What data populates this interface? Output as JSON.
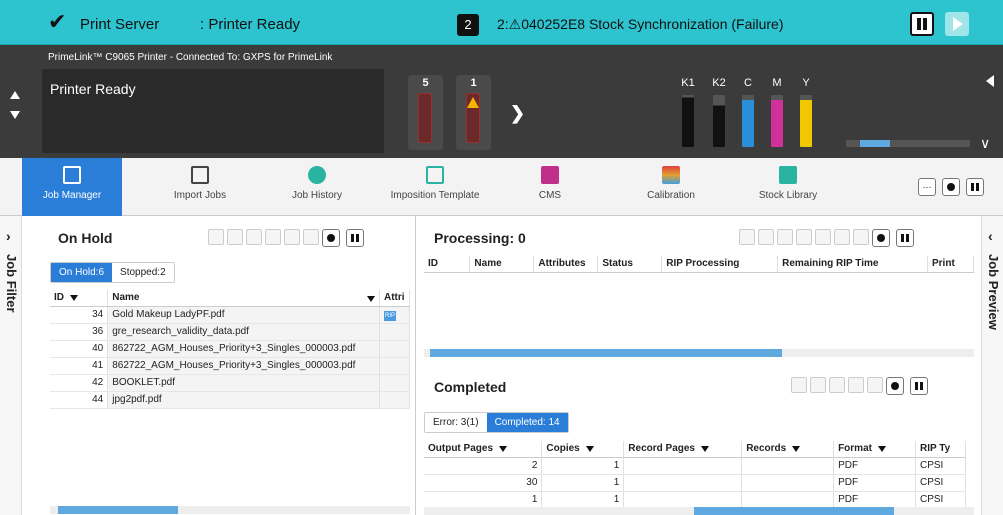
{
  "status_bar": {
    "server_label": "Print Server",
    "printer_status": ": Printer Ready",
    "job_count": "2",
    "message": "2:⚠040252E8 Stock Synchronization (Failure)"
  },
  "printer": {
    "connection": "PrimeLink™ C9065 Printer - Connected To: GXPS for PrimeLink",
    "screen_text": "Printer Ready",
    "trays": [
      {
        "label": "5",
        "warning": false
      },
      {
        "label": "1",
        "warning": true
      }
    ],
    "inks": [
      {
        "label": "K1",
        "color": "#111111",
        "level": 0.95
      },
      {
        "label": "K2",
        "color": "#111111",
        "level": 0.8
      },
      {
        "label": "C",
        "color": "#2a8fd8",
        "level": 0.9
      },
      {
        "label": "M",
        "color": "#d0309a",
        "level": 0.9
      },
      {
        "label": "Y",
        "color": "#f0c800",
        "level": 0.9
      }
    ]
  },
  "nav": {
    "items": [
      {
        "label": "Job Manager",
        "icon": "job-manager-icon",
        "color": "#ffffff"
      },
      {
        "label": "Import Jobs",
        "icon": "import-icon",
        "color": "#444444"
      },
      {
        "label": "Job History",
        "icon": "history-icon",
        "color": "#2ab3a0"
      },
      {
        "label": "Imposition Template",
        "icon": "imposition-icon",
        "color": "#2ab3a0"
      },
      {
        "label": "CMS",
        "icon": "cms-icon",
        "color": "#c0308a"
      },
      {
        "label": "Calibration",
        "icon": "calibration-icon",
        "color": "#e08a30"
      },
      {
        "label": "Stock Library",
        "icon": "stock-library-icon",
        "color": "#2ab3a0"
      }
    ]
  },
  "sidebars": {
    "left": "Job Filter",
    "right": "Job Preview"
  },
  "on_hold": {
    "title": "On Hold",
    "tabs": [
      "On Hold:6",
      "Stopped:2"
    ],
    "columns": [
      "ID",
      "Name",
      "Attri"
    ],
    "rows": [
      {
        "id": "34",
        "name": "Gold Makeup LadyPF.pdf",
        "rip": true
      },
      {
        "id": "36",
        "name": "gre_research_validity_data.pdf",
        "rip": false
      },
      {
        "id": "40",
        "name": "862722_AGM_Houses_Priority+3_Singles_000003.pdf",
        "rip": false
      },
      {
        "id": "41",
        "name": "862722_AGM_Houses_Priority+3_Singles_000003.pdf",
        "rip": false
      },
      {
        "id": "42",
        "name": "BOOKLET.pdf",
        "rip": false
      },
      {
        "id": "44",
        "name": "jpg2pdf.pdf",
        "rip": false
      }
    ]
  },
  "processing": {
    "title": "Processing: 0",
    "columns": [
      "ID",
      "Name",
      "Attributes",
      "Status",
      "RIP Processing",
      "Remaining RIP Time",
      "Print"
    ]
  },
  "completed": {
    "title": "Completed",
    "tabs": [
      "Error: 3(1)",
      "Completed: 14"
    ],
    "columns": [
      "Output Pages",
      "Copies",
      "Record Pages",
      "Records",
      "Format",
      "RIP Ty"
    ],
    "rows": [
      {
        "output_pages": "2",
        "copies": "1",
        "record_pages": "",
        "records": "",
        "format": "PDF",
        "rip_type": "CPSI"
      },
      {
        "output_pages": "30",
        "copies": "1",
        "record_pages": "",
        "records": "",
        "format": "PDF",
        "rip_type": "CPSI"
      },
      {
        "output_pages": "1",
        "copies": "1",
        "record_pages": "",
        "records": "",
        "format": "PDF",
        "rip_type": "CPSI"
      }
    ]
  }
}
